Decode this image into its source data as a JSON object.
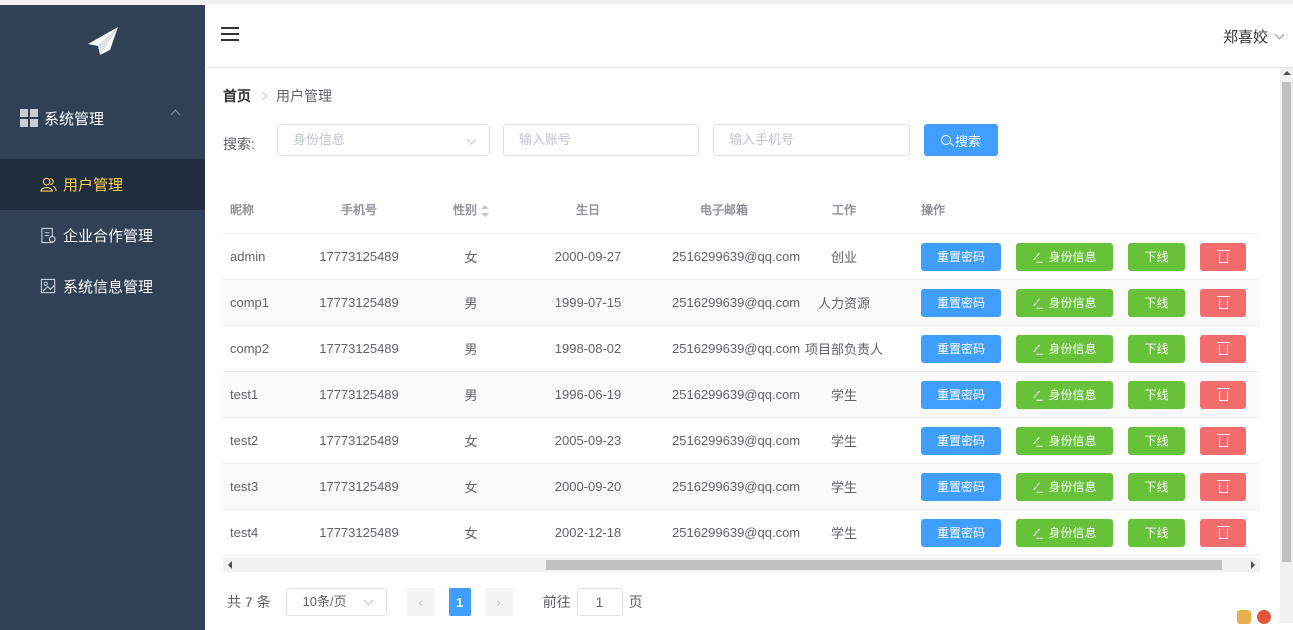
{
  "sidebar": {
    "group_label": "系统管理",
    "items": [
      {
        "label": "用户管理",
        "active": true
      },
      {
        "label": "企业合作管理",
        "active": false
      },
      {
        "label": "系统信息管理",
        "active": false
      }
    ]
  },
  "header": {
    "user_name": "郑喜姣"
  },
  "breadcrumb": {
    "home": "首页",
    "current": "用户管理"
  },
  "search": {
    "label": "搜索:",
    "select_placeholder": "身份信息",
    "account_placeholder": "输入账号",
    "phone_placeholder": "输入手机号",
    "button_label": "搜索"
  },
  "table": {
    "columns": [
      "昵称",
      "手机号",
      "性别",
      "生日",
      "电子邮箱",
      "工作",
      "操作"
    ],
    "actions": {
      "reset": "重置密码",
      "identity": "身份信息",
      "offline": "下线"
    },
    "rows": [
      {
        "nickname": "admin",
        "phone": "17773125489",
        "gender": "女",
        "birthday": "2000-09-27",
        "email": "2516299639@qq.com",
        "job": "创业"
      },
      {
        "nickname": "comp1",
        "phone": "17773125489",
        "gender": "男",
        "birthday": "1999-07-15",
        "email": "2516299639@qq.com",
        "job": "人力资源"
      },
      {
        "nickname": "comp2",
        "phone": "17773125489",
        "gender": "男",
        "birthday": "1998-08-02",
        "email": "2516299639@qq.com",
        "job": "项目部负责人"
      },
      {
        "nickname": "test1",
        "phone": "17773125489",
        "gender": "男",
        "birthday": "1996-06-19",
        "email": "2516299639@qq.com",
        "job": "学生"
      },
      {
        "nickname": "test2",
        "phone": "17773125489",
        "gender": "女",
        "birthday": "2005-09-23",
        "email": "2516299639@qq.com",
        "job": "学生"
      },
      {
        "nickname": "test3",
        "phone": "17773125489",
        "gender": "女",
        "birthday": "2000-09-20",
        "email": "2516299639@qq.com",
        "job": "学生"
      },
      {
        "nickname": "test4",
        "phone": "17773125489",
        "gender": "女",
        "birthday": "2002-12-18",
        "email": "2516299639@qq.com",
        "job": "学生"
      }
    ]
  },
  "pagination": {
    "total": "共 7 条",
    "page_size": "10条/页",
    "current_page": "1",
    "goto_label": "前往",
    "goto_value": "1",
    "page_suffix": "页"
  },
  "colors": {
    "sidebar_bg": "#304156",
    "active_text": "#ffd04b",
    "primary": "#409eff",
    "success": "#67c23a",
    "danger": "#f56c6c"
  }
}
